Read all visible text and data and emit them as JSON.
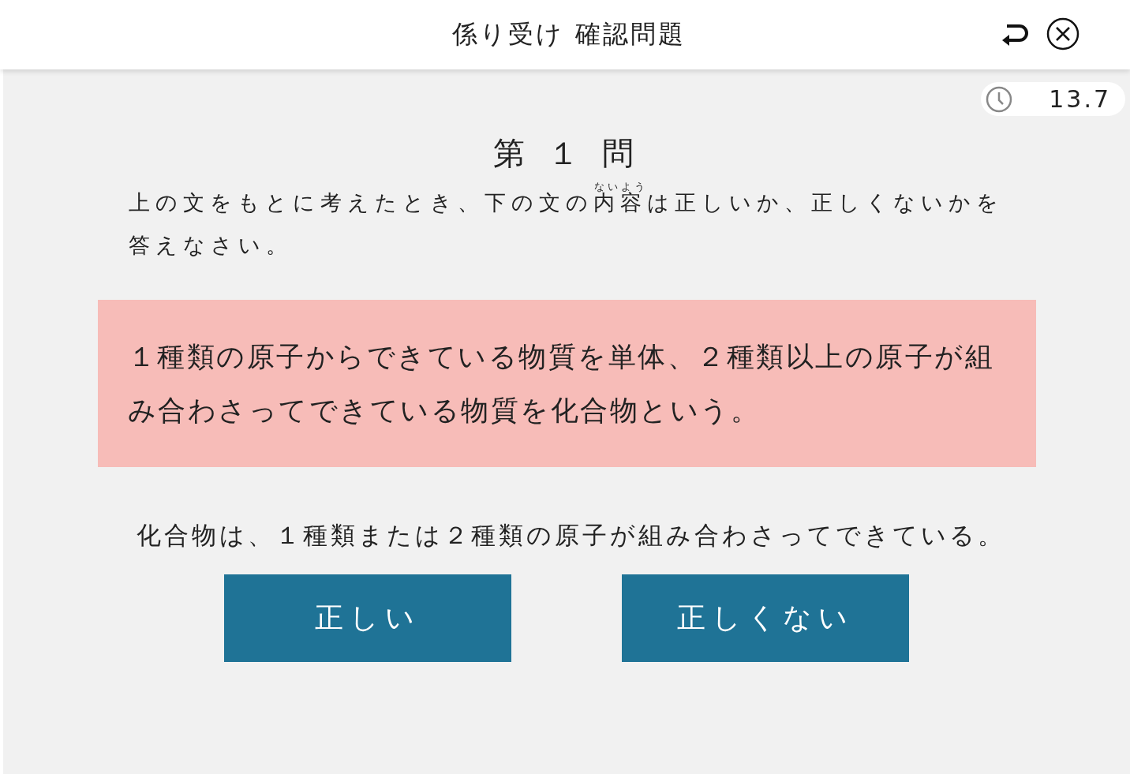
{
  "header": {
    "title": "係り受け 確認問題"
  },
  "timer": {
    "value": "13.7"
  },
  "question": {
    "number": "第 １ 問",
    "instruction_before": "上の文をもとに考えたとき、下の文の",
    "ruby_base": "内容",
    "ruby_text": "ないよう",
    "instruction_after": "は正しいか、正しくないかを答えなさい。",
    "source_sentence": "１種類の原子からできている物質を単体、２種類以上の原子が組み合わさってできている物質を化合物という。",
    "statement": "化合物は、１種類または２種類の原子が組み合わさってできている。"
  },
  "answers": [
    {
      "label": "正しい"
    },
    {
      "label": "正しくない"
    }
  ]
}
